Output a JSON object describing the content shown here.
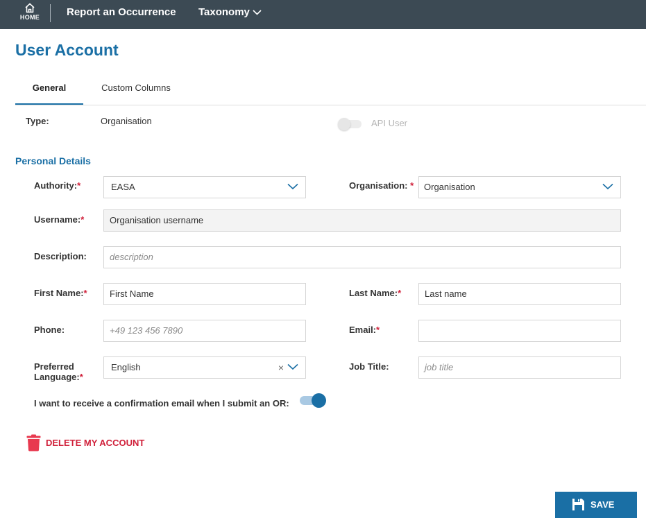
{
  "topbar": {
    "home_label": "HOME",
    "nav": {
      "report": "Report an Occurrence",
      "taxonomy": "Taxonomy"
    }
  },
  "page": {
    "title": "User Account"
  },
  "tabs": [
    {
      "label": "General",
      "active": true
    },
    {
      "label": "Custom Columns",
      "active": false
    }
  ],
  "account": {
    "type_label": "Type:",
    "type_value": "Organisation",
    "api_user_label": "API User",
    "api_user_enabled": false
  },
  "personal_details": {
    "title": "Personal Details",
    "authority": {
      "label": "Authority:",
      "value": "EASA"
    },
    "organisation": {
      "label": "Organisation:",
      "value": "Organisation"
    },
    "username": {
      "label": "Username:",
      "value": "Organisation username"
    },
    "description": {
      "label": "Description:",
      "placeholder": "description",
      "value": ""
    },
    "first_name": {
      "label": "First Name:",
      "value": "First Name"
    },
    "last_name": {
      "label": "Last Name:",
      "value": "Last name"
    },
    "phone": {
      "label": "Phone:",
      "placeholder": "+49 123 456 7890",
      "value": ""
    },
    "email": {
      "label": "Email:",
      "value": ""
    },
    "preferred_language": {
      "label_line1": "Preferred",
      "label_line2": "Language:",
      "value": "English"
    },
    "job_title": {
      "label": "Job Title:",
      "placeholder": "job title",
      "value": ""
    },
    "confirmation_email": {
      "label": "I want to receive a confirmation email when I submit an OR:",
      "enabled": true
    }
  },
  "actions": {
    "delete_label": "DELETE MY ACCOUNT",
    "save_label": "SAVE"
  },
  "required_marker": "*",
  "colors": {
    "topbar": "#3c4a54",
    "accent": "#1a6fa5",
    "danger": "#d0203a"
  },
  "icons": [
    "home-icon",
    "chevron-down-icon",
    "clear-icon",
    "trash-icon",
    "floppy-disk-icon"
  ]
}
